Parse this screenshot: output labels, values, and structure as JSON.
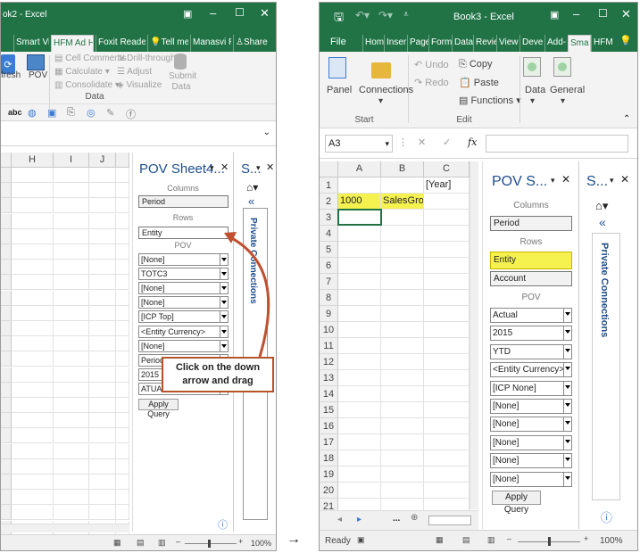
{
  "left": {
    "title": "ok2 - Excel",
    "tabs": [
      "Smart View",
      "HFM Ad Hoc",
      "Foxit Reader PD",
      "Tell me...",
      "Manasvi R...",
      "Share"
    ],
    "active_tab": "HFM Ad Hoc",
    "ribbon": {
      "refresh": "fresh",
      "pov": "POV",
      "cell_comments": "Cell Comments",
      "drill_through": "Drill-through",
      "calculate": "Calculate",
      "adjust": "Adjust",
      "consolidate": "Consolidate",
      "visualize": "Visualize",
      "submit_data": "Submit Data",
      "group_label": "Data"
    },
    "columns": [
      "H",
      "I",
      "J"
    ],
    "pov_panel": {
      "title": "POV Sheet4...",
      "columns_label": "Columns",
      "columns_value": "Period",
      "rows_label": "Rows",
      "rows_value": "Entity",
      "pov_label": "POV",
      "dropdowns": [
        "[None]",
        "TOTC3",
        "[None]",
        "[None]",
        "[ICP Top]",
        "<Entity Currency>",
        "[None]",
        "Periodic",
        "2015",
        "ATUAL"
      ],
      "apply_query": "Apply Query"
    },
    "side_panel": {
      "title": "S...",
      "vertical_label": "Private Connections"
    },
    "callout": "Click on the down arrow and drag",
    "zoom": "100%"
  },
  "arrow": "→",
  "right": {
    "title": "Book3 - Excel",
    "tabs": [
      "File",
      "Hom",
      "Inser",
      "Page",
      "Form",
      "Data",
      "Revie",
      "View",
      "Deve",
      "Add-",
      "Sma",
      "HFM"
    ],
    "active_tab": "Sma",
    "ribbon": {
      "panel": "Panel",
      "connections": "Connections",
      "undo": "Undo",
      "redo": "Redo",
      "copy": "Copy",
      "paste": "Paste",
      "functions": "Functions",
      "data": "Data",
      "general": "General",
      "start_group": "Start",
      "edit_group": "Edit"
    },
    "name_box": "A3",
    "fx": "fx",
    "columns": [
      "A",
      "B",
      "C"
    ],
    "rows": [
      "1",
      "2",
      "3",
      "4",
      "5",
      "6",
      "7",
      "8",
      "9",
      "10",
      "11",
      "12",
      "13",
      "14",
      "15",
      "16",
      "17",
      "18",
      "19",
      "20",
      "21"
    ],
    "cells": {
      "c1": "[Year]",
      "a2": "1000",
      "b2": "SalesGross"
    },
    "pov_panel": {
      "title": "POV S...",
      "columns_label": "Columns",
      "columns_value": "Period",
      "rows_label": "Rows",
      "rows_values": [
        "Entity",
        "Account"
      ],
      "pov_label": "POV",
      "dropdowns": [
        "Actual",
        "2015",
        "YTD",
        "<Entity Currency>",
        "[ICP None]",
        "[None]",
        "[None]",
        "[None]",
        "[None]",
        "[None]"
      ],
      "apply_query": "Apply Query",
      "highlight_color": "#f5f250"
    },
    "side_panel": {
      "title": "S...",
      "vertical_label": "Private Connections"
    },
    "status": "Ready",
    "zoom": "100%"
  },
  "colors": {
    "excel_green": "#217346",
    "pov_blue": "#1e4e8c",
    "callout_border": "#b5532a",
    "arrow_red": "#c0502f",
    "cell_highlight": "#f5f250"
  }
}
